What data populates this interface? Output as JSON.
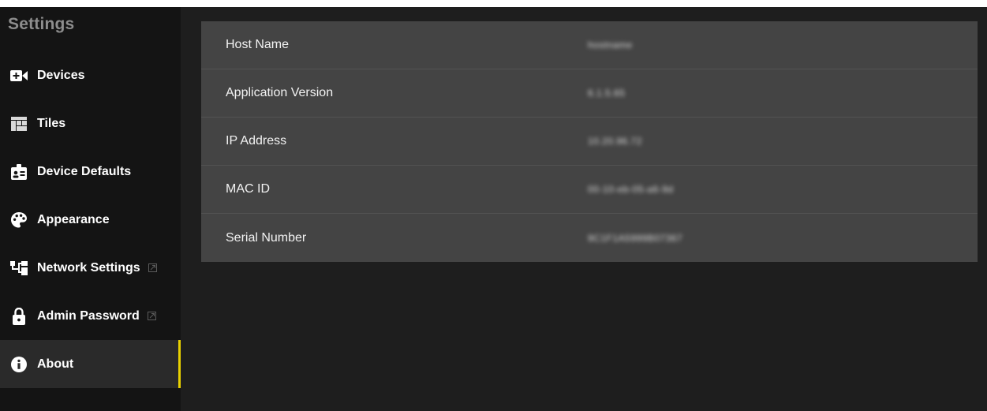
{
  "sidebar": {
    "title": "Settings",
    "items": [
      {
        "label": "Devices",
        "icon": "video-plus-icon"
      },
      {
        "label": "Tiles",
        "icon": "grid-icon"
      },
      {
        "label": "Device Defaults",
        "icon": "badge-icon"
      },
      {
        "label": "Appearance",
        "icon": "palette-icon"
      },
      {
        "label": "Network Settings",
        "icon": "network-icon",
        "external": true
      },
      {
        "label": "Admin Password",
        "icon": "lock-icon",
        "external": true
      },
      {
        "label": "About",
        "icon": "info-icon",
        "selected": true
      }
    ],
    "selected_accent": "#e8d100"
  },
  "about": {
    "rows": [
      {
        "label": "Host Name",
        "value": "hostname"
      },
      {
        "label": "Application Version",
        "value": "6.1.5.65"
      },
      {
        "label": "IP Address",
        "value": "10.20.96.72"
      },
      {
        "label": "MAC ID",
        "value": "00-10-eb-05-a6-9d"
      },
      {
        "label": "Serial Number",
        "value": "9C1F1A5999B07367"
      }
    ]
  }
}
